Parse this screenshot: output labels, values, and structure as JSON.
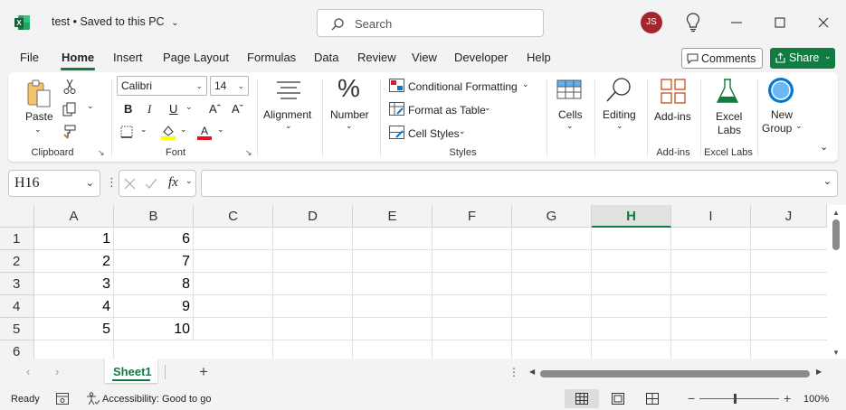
{
  "title_bar": {
    "doc_title": "test  •  Saved to this PC",
    "search_placeholder": "Search",
    "user_initials": "JS",
    "colors": {
      "accent": "#107c41",
      "avatar": "#a4262c"
    }
  },
  "menu": {
    "tabs": [
      "File",
      "Home",
      "Insert",
      "Page Layout",
      "Formulas",
      "Data",
      "Review",
      "View",
      "Developer",
      "Help"
    ],
    "active": "Home",
    "comments_label": "Comments",
    "share_label": "Share"
  },
  "ribbon": {
    "clipboard": {
      "paste_label": "Paste",
      "group_label": "Clipboard"
    },
    "font": {
      "font_name": "Calibri",
      "font_size": "14",
      "group_label": "Font"
    },
    "alignment": {
      "label": "Alignment"
    },
    "number": {
      "label": "Number"
    },
    "styles": {
      "conditional_formatting": "Conditional Formatting",
      "format_as_table": "Format as Table",
      "cell_styles": "Cell Styles",
      "group_label": "Styles"
    },
    "cells": {
      "label": "Cells"
    },
    "editing": {
      "label": "Editing"
    },
    "addins": {
      "label": "Add-ins",
      "group_label": "Add-ins"
    },
    "excel_labs": {
      "label_line1": "Excel",
      "label_line2": "Labs",
      "group_label": "Excel Labs"
    },
    "new_group": {
      "label_line1": "New",
      "label_line2": "Group"
    }
  },
  "formula_bar": {
    "name_box": "H16",
    "fx_label": "fx",
    "formula": ""
  },
  "grid": {
    "columns": [
      "A",
      "B",
      "C",
      "D",
      "E",
      "F",
      "G",
      "H",
      "I",
      "J"
    ],
    "selected_column": "H",
    "rows": [
      {
        "row": "1",
        "A": "1",
        "B": "6"
      },
      {
        "row": "2",
        "A": "2",
        "B": "7"
      },
      {
        "row": "3",
        "A": "3",
        "B": "8"
      },
      {
        "row": "4",
        "A": "4",
        "B": "9"
      },
      {
        "row": "5",
        "A": "5",
        "B": "10"
      },
      {
        "row": "6",
        "A": "",
        "B": ""
      }
    ]
  },
  "sheets": {
    "tabs": [
      "Sheet1"
    ],
    "active": "Sheet1"
  },
  "status": {
    "ready": "Ready",
    "accessibility": "Accessibility: Good to go",
    "zoom": "100%"
  }
}
